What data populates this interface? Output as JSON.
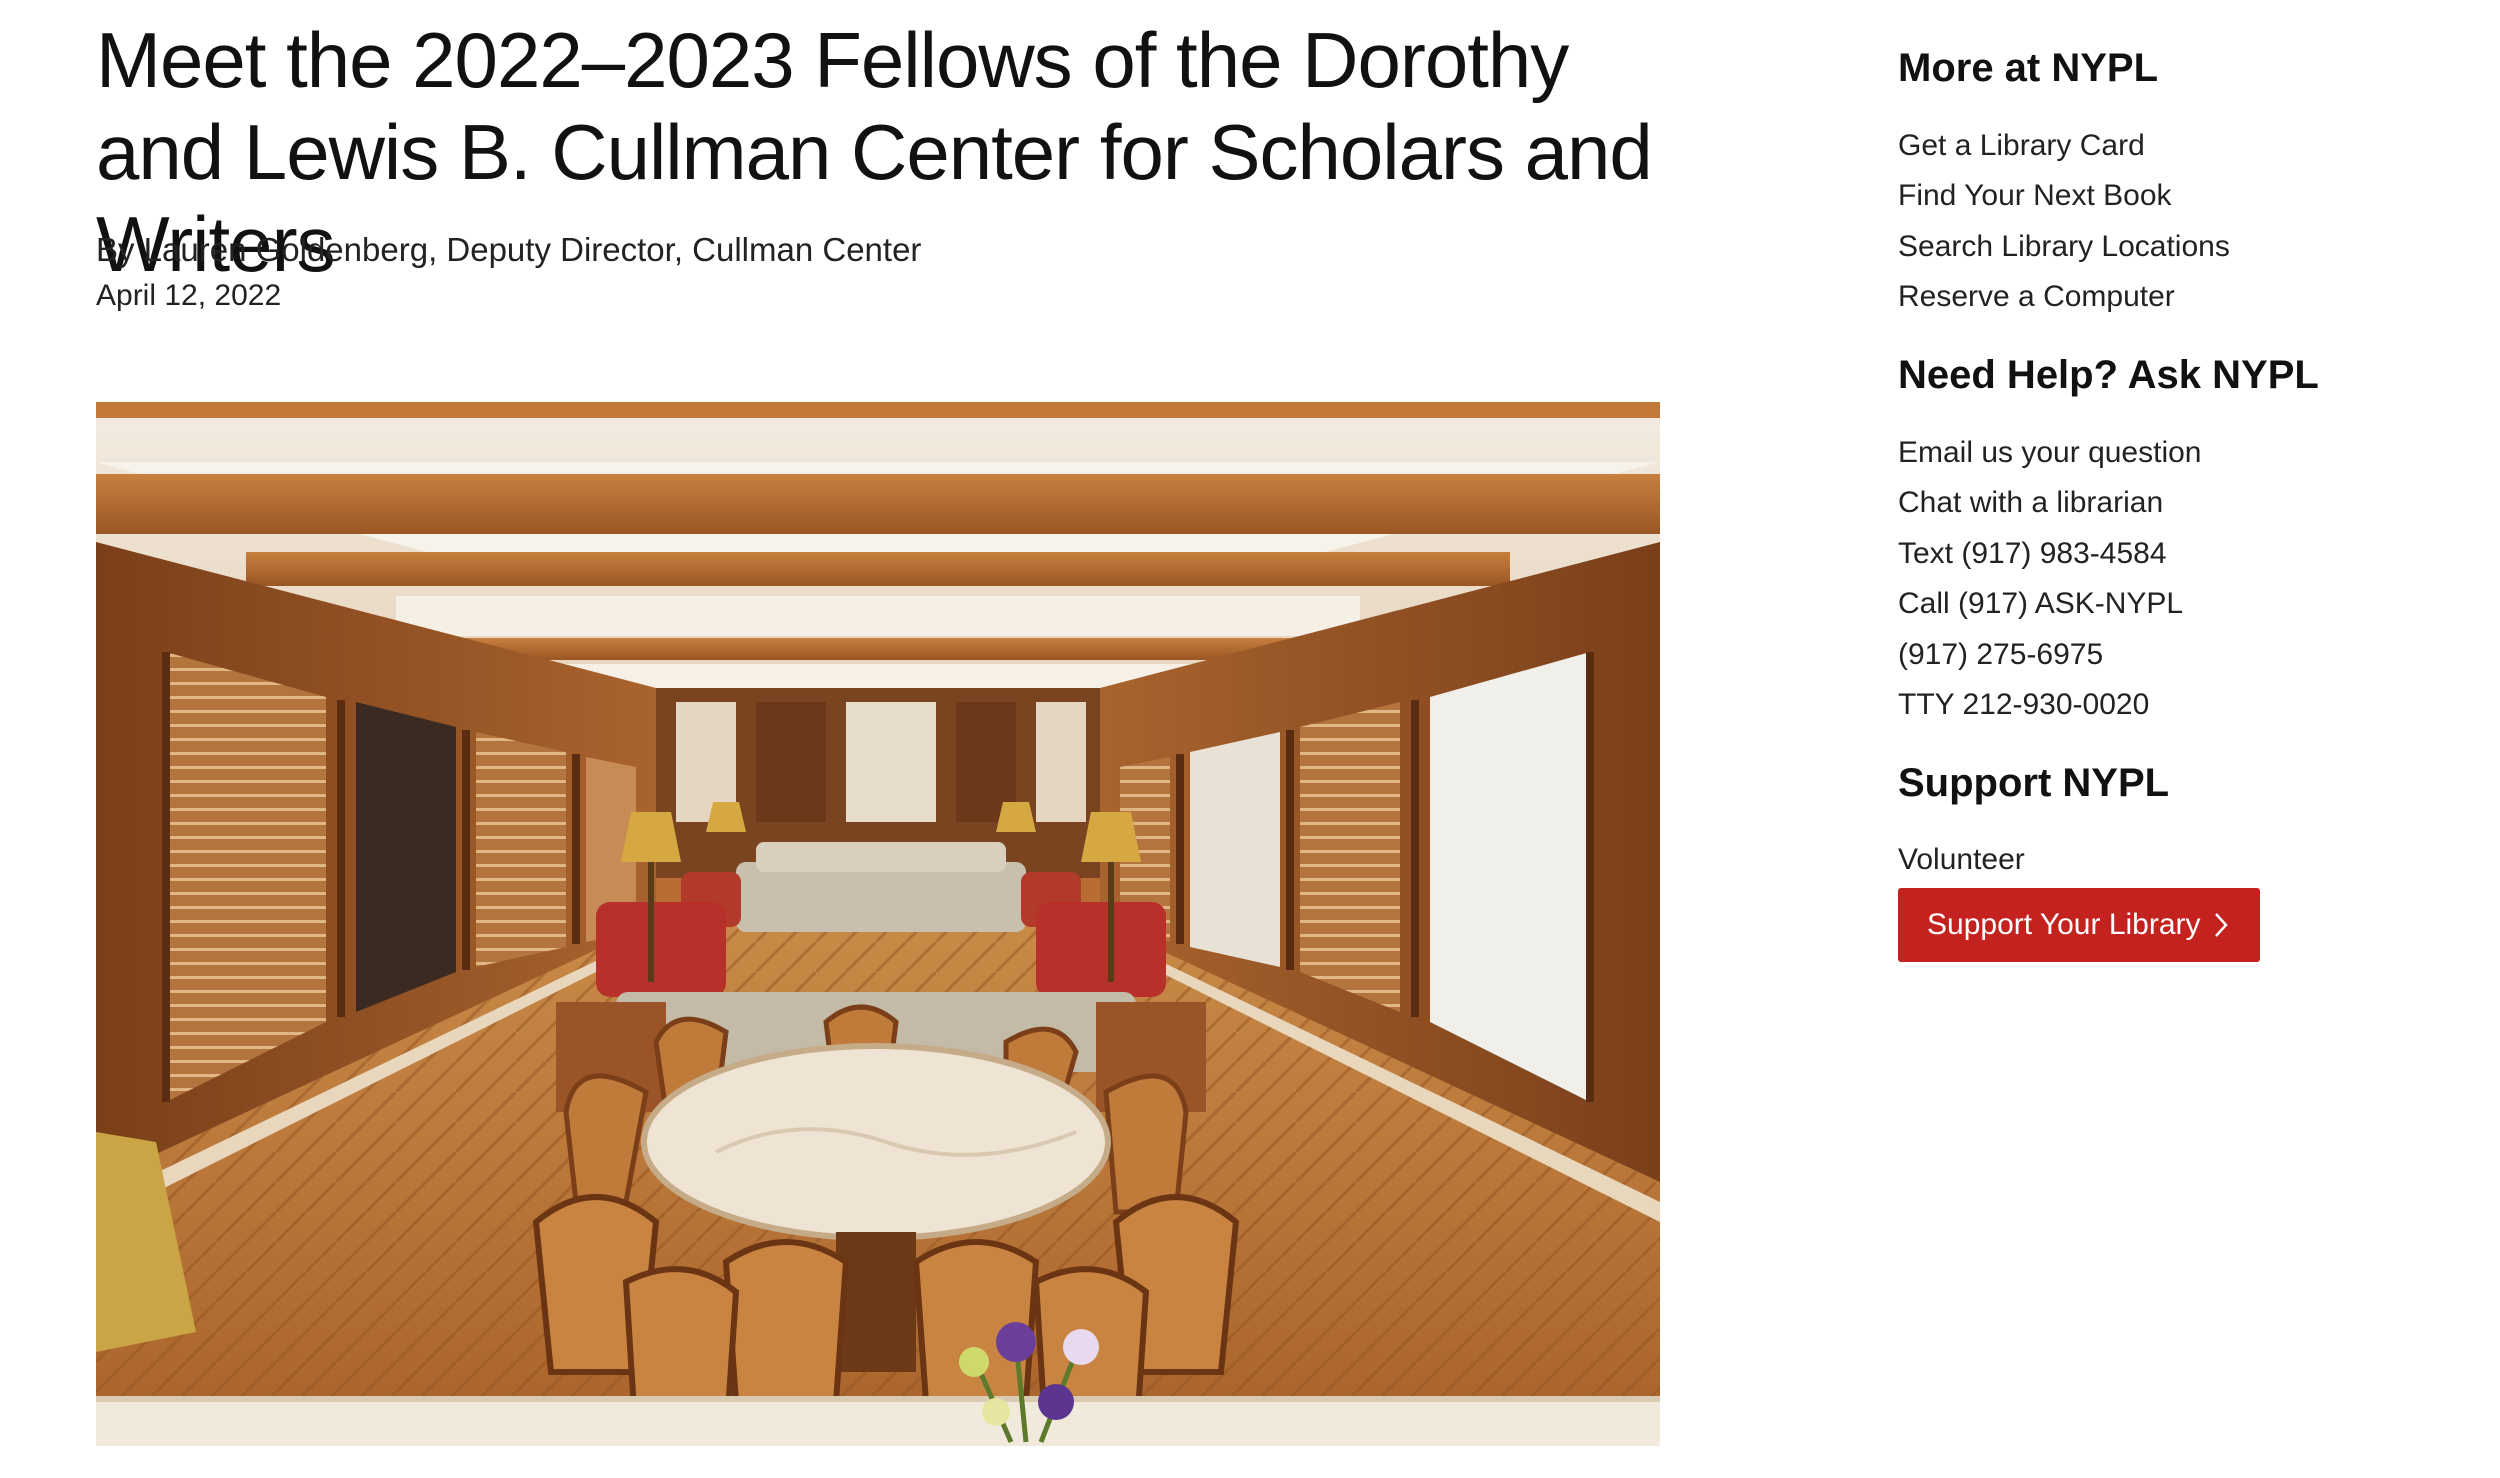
{
  "article": {
    "title": "Meet the 2022–2023 Fellows of the Dorothy and Lewis B. Cullman Center for Scholars and Writers",
    "byline": "By Lauren Goldenberg, Deputy Director, Cullman Center",
    "date": "April 12, 2022"
  },
  "sidebar": {
    "more_heading": "More at NYPL",
    "more_links": [
      "Get a Library Card",
      "Find Your Next Book",
      "Search Library Locations",
      "Reserve a Computer"
    ],
    "help_heading": "Need Help? Ask NYPL",
    "help_links": [
      "Email us your question",
      "Chat with a librarian",
      "Text (917) 983-4584",
      "Call (917) ASK-NYPL",
      "(917) 275-6975",
      "TTY 212-930-0020"
    ],
    "support_heading": "Support NYPL",
    "volunteer_label": "Volunteer",
    "support_button_label": "Support Your Library"
  },
  "colors": {
    "brand_red": "#c4221f",
    "text": "#111111"
  },
  "icons": {
    "support_button": "chevron-right-icon"
  }
}
